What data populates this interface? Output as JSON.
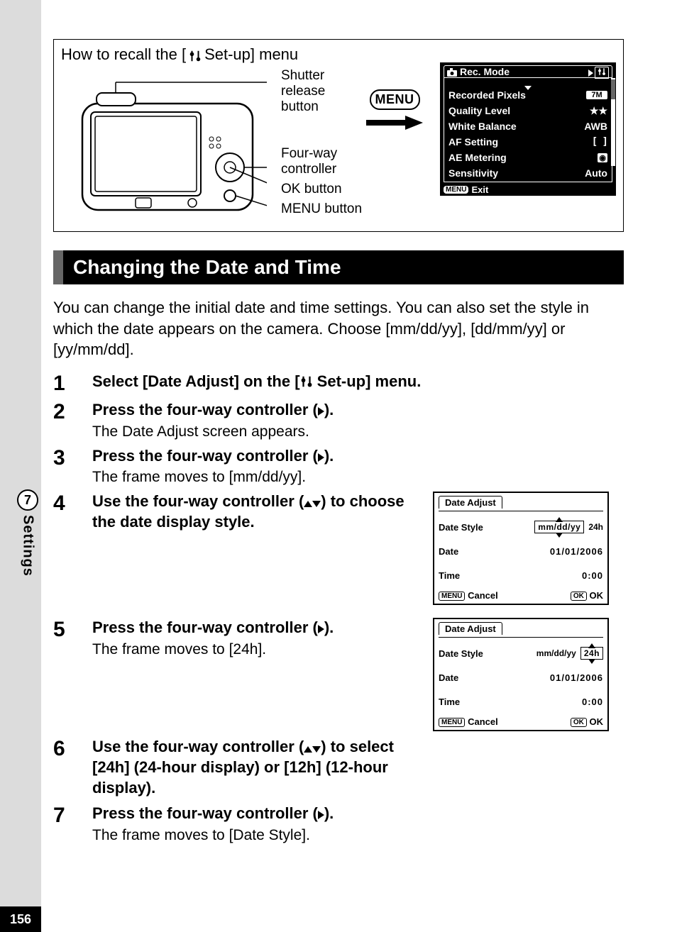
{
  "page_number": "156",
  "side_tab": {
    "chapter": "7",
    "label": "Settings"
  },
  "recall": {
    "title_prefix": "How to recall the [",
    "title_suffix": " Set-up] menu",
    "labels": {
      "shutter": "Shutter release button",
      "four_way": "Four-way controller",
      "ok": "OK button",
      "menu": "MENU button"
    },
    "menu_button": "MENU",
    "rec_mode": {
      "header": "Rec. Mode",
      "items": [
        {
          "label": "Recorded Pixels",
          "value": "7M"
        },
        {
          "label": "Quality Level",
          "value": "★★"
        },
        {
          "label": "White Balance",
          "value": "AWB"
        },
        {
          "label": "AF Setting",
          "value": "[  ]"
        },
        {
          "label": "AE Metering",
          "value": "◎"
        },
        {
          "label": "Sensitivity",
          "value": "Auto"
        }
      ],
      "footer_menu": "MENU",
      "footer_exit": "Exit"
    }
  },
  "section_title": "Changing the Date and Time",
  "intro": "You can change the initial date and time settings. You can also set the style in which the date appears on the camera. Choose [mm/dd/yy], [dd/mm/yy] or [yy/mm/dd].",
  "steps": [
    {
      "num": "1",
      "title_prefix": "Select [Date Adjust] on the [",
      "title_suffix": " Set-up] menu."
    },
    {
      "num": "2",
      "title": "Press the four-way controller (▶).",
      "desc": "The Date Adjust screen appears."
    },
    {
      "num": "3",
      "title": "Press the four-way controller (▶).",
      "desc": "The frame moves to [mm/dd/yy]."
    },
    {
      "num": "4",
      "title": "Use the four-way controller (▲▼) to choose the date display style."
    },
    {
      "num": "5",
      "title": "Press the four-way controller (▶).",
      "desc": "The frame moves to [24h]."
    },
    {
      "num": "6",
      "title": "Use the four-way controller (▲▼) to select [24h] (24-hour display) or [12h] (12-hour display)."
    },
    {
      "num": "7",
      "title": "Press the four-way controller (▶).",
      "desc": "The frame moves to [Date Style]."
    }
  ],
  "date_adjust": {
    "header": "Date Adjust",
    "rows": {
      "style_label": "Date Style",
      "style_value_fmt": "mm/dd/yy",
      "style_value_hour": "24h",
      "date_label": "Date",
      "date_value": "01/01/2006",
      "time_label": "Time",
      "time_value": "0:00"
    },
    "footer": {
      "menu": "MENU",
      "cancel": "Cancel",
      "ok_pill": "OK",
      "ok": "OK"
    }
  }
}
